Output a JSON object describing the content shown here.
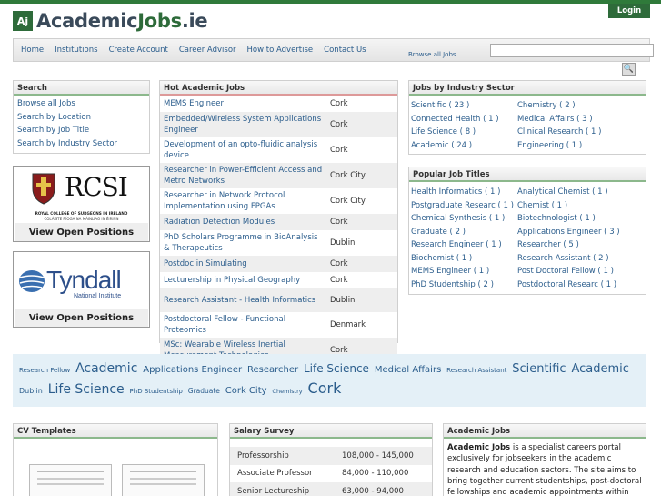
{
  "site": {
    "logo_mark": "Aj",
    "name_part1": "Academic",
    "name_part2": "Jobs",
    "name_part3": ".ie",
    "login": "Login"
  },
  "nav": {
    "items": [
      "Home",
      "Institutions",
      "Create Account",
      "Career Advisor",
      "How to Advertise",
      "Contact Us"
    ],
    "browse": "Browse all Jobs",
    "search_placeholder": ""
  },
  "search": {
    "title": "Search",
    "links": [
      "Browse all Jobs",
      "Search by Location",
      "Search by Job Title",
      "Search by Industry Sector"
    ]
  },
  "banners": [
    {
      "org": "RCSI",
      "sub": "ROYAL COLLEGE OF SURGEONS IN IRELAND",
      "sub2": "COLÁISTE RÍOGA NA MÁINLIAG IN ÉIRINN",
      "cap": "View Open Positions"
    },
    {
      "org": "Tyndall",
      "sub": "National Institute",
      "cap": "View Open Positions"
    }
  ],
  "hot": {
    "title": "Hot Academic Jobs",
    "rows": [
      [
        "MEMS Engineer",
        "Cork"
      ],
      [
        "Embedded/Wireless System Applications Engineer",
        "Cork"
      ],
      [
        "Development of an opto-fluidic analysis device",
        "Cork"
      ],
      [
        "Researcher in Power-Efficient Access and Metro Networks",
        "Cork City"
      ],
      [
        "Researcher in Network Protocol Implementation using FPGAs",
        "Cork City"
      ],
      [
        "Radiation Detection Modules",
        "Cork"
      ],
      [
        "PhD Scholars Programme in BioAnalysis & Therapeutics",
        "Dublin"
      ],
      [
        "Postdoc in Simulating",
        "Cork"
      ],
      [
        "Lecturership in Physical Geography",
        "Cork"
      ],
      [
        "Research Assistant - Health Informatics",
        "Dublin"
      ],
      [
        "Postdoctoral Fellow - Functional Proteomics",
        "Denmark"
      ],
      [
        "MSc: Wearable Wireless Inertial Measurement Technologies",
        "Cork"
      ]
    ]
  },
  "sector": {
    "title": "Jobs by Industry Sector",
    "items": [
      "Scientific ( 23 )",
      "Chemistry ( 2 )",
      "Connected Health ( 1 )",
      "Medical Affairs ( 3 )",
      "Life Science ( 8 )",
      "Clinical Research ( 1 )",
      "Academic ( 24 )",
      "Engineering ( 1 )"
    ]
  },
  "titles": {
    "title": "Popular Job Titles",
    "items": [
      "Health Informatics ( 1 )",
      "Analytical Chemist ( 1 )",
      "Postgraduate Researc ( 1 )",
      "Chemist ( 1 )",
      "Chemical Synthesis ( 1 )",
      "Biotechnologist ( 1 )",
      "Graduate ( 2 )",
      "Applications Engineer ( 3 )",
      "Research Engineer ( 1 )",
      "Researcher ( 5 )",
      "Biochemist ( 1 )",
      "Research Assistant ( 2 )",
      "MEMS Engineer ( 1 )",
      "Post Doctoral Fellow ( 1 )",
      "PhD Studentship ( 2 )",
      "Postdoctoral Researc ( 1 )"
    ]
  },
  "cloud": [
    {
      "t": "Research Fellow",
      "s": 7
    },
    {
      "t": "Academic",
      "s": 14
    },
    {
      "t": "Applications Engineer",
      "s": 10
    },
    {
      "t": "Researcher",
      "s": 10
    },
    {
      "t": "Life Science",
      "s": 12
    },
    {
      "t": "Medical Affairs",
      "s": 10
    },
    {
      "t": "Research Assistant",
      "s": 7
    },
    {
      "t": "Scientific",
      "s": 13
    },
    {
      "t": "Academic",
      "s": 13
    },
    {
      "t": "Dublin",
      "s": 8
    },
    {
      "t": "Life Science",
      "s": 14
    },
    {
      "t": "PhD Studentship",
      "s": 7
    },
    {
      "t": "Graduate",
      "s": 7.5
    },
    {
      "t": "Cork City",
      "s": 10
    },
    {
      "t": "Chemistry",
      "s": 6.5
    },
    {
      "t": "Cork",
      "s": 16
    }
  ],
  "cv": {
    "title": "CV Templates"
  },
  "salary": {
    "title": "Salary Survey",
    "rows": [
      [
        "Professorship",
        "108,000 - 145,000"
      ],
      [
        "Associate Professor",
        "84,000 - 110,000"
      ],
      [
        "Senior Lectureship",
        "63,000 - 94,000"
      ]
    ]
  },
  "about": {
    "title": "Academic Jobs",
    "bold": "Academic Jobs",
    "text": " is a specialist careers portal exclusively for jobseekers in the academic research and education sectors. The site aims to bring together current studentships, post-doctoral fellowships and academic appointments within one"
  }
}
